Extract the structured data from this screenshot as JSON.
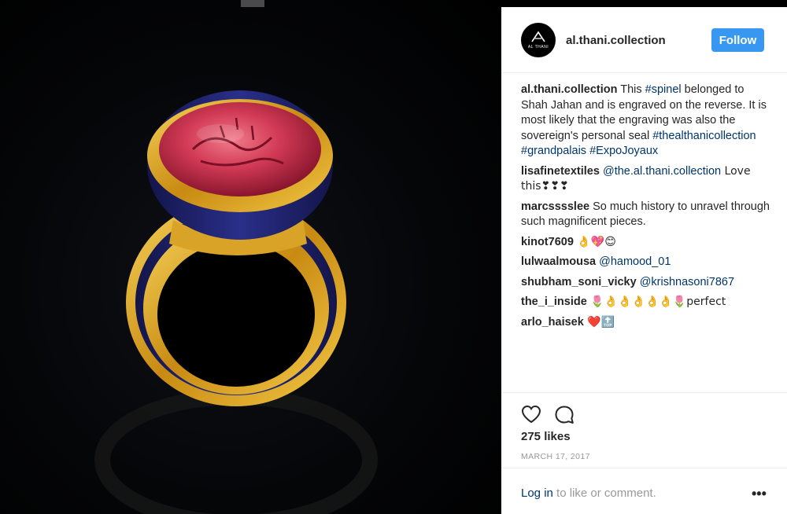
{
  "post": {
    "username": "al.thani.collection",
    "avatar_text": "AL THANI",
    "follow_label": "Follow",
    "caption": {
      "username": "al.thani.collection",
      "text_1": " This ",
      "tag_1": "#spinel",
      "text_2": " belonged to Shah Jahan and is engraved on the reverse. It is most likely that the engraving was also the sovereign's personal seal ",
      "tag_2": "#thealthanicollection",
      "tag_3": "#grandpalais",
      "tag_4": "#ExpoJoyaux"
    },
    "comments": [
      {
        "username": "lisafinetextiles",
        "mention": "@the.al.thani.collection",
        "text": " Love this❣❣❣"
      },
      {
        "username": "marcsssslee",
        "text": " So much history to unravel through such magnificent pieces."
      },
      {
        "username": "kinot7609",
        "text": " 👌💖😊"
      },
      {
        "username": "lulwaalmousa",
        "mention": "@hamood_01",
        "text": ""
      },
      {
        "username": "shubham_soni_vicky",
        "mention": "@krishnasoni7867",
        "text": ""
      },
      {
        "username": "the_i_inside",
        "text": " 🌷👌👌👌👌👌🌷perfect"
      },
      {
        "username": "arlo_haisek",
        "text": " ❤️🔝"
      }
    ],
    "likes": "275 likes",
    "date": "MARCH 17, 2017",
    "login_link": "Log in",
    "login_text": " to like or comment.",
    "more_label": "•••"
  },
  "colors": {
    "follow": "#3897f0",
    "link": "#003569",
    "muted": "#999999",
    "ring_gold": "#d9a21f",
    "ring_enamel": "#1c1f6e",
    "gem": "#c4334a"
  },
  "icons": {
    "like": "heart-icon",
    "comment": "comment-icon",
    "more": "more-options-icon"
  }
}
